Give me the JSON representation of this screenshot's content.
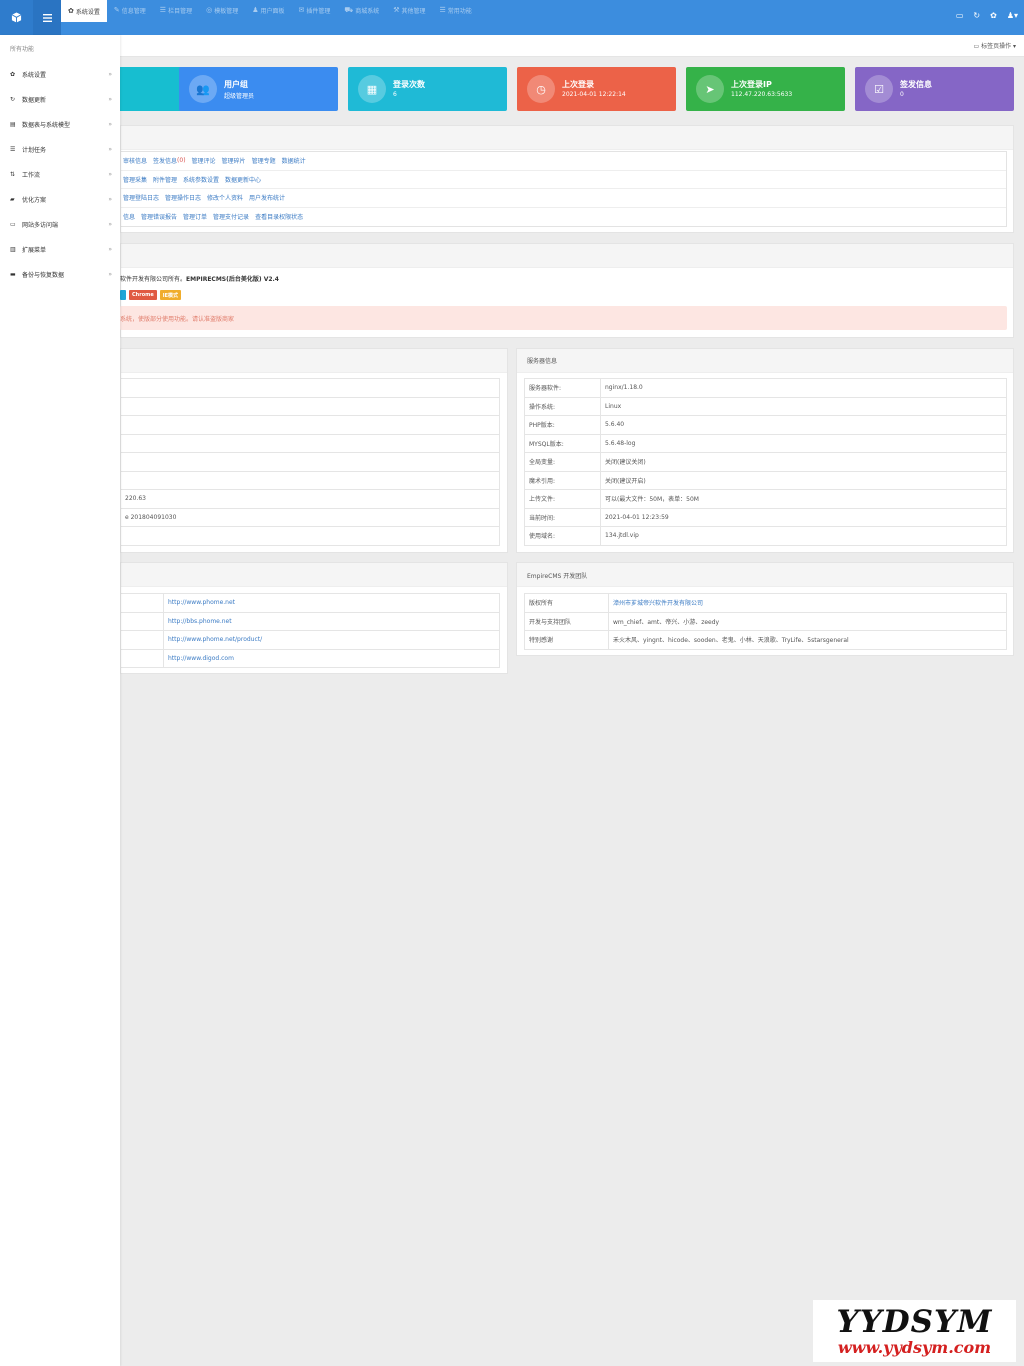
{
  "topbar": {
    "nav": [
      {
        "icon": "gear-icon",
        "glyph": "✿",
        "label": "系统设置",
        "active": true
      },
      {
        "icon": "pencil-icon",
        "glyph": "✎",
        "label": "信息管理",
        "active": false
      },
      {
        "icon": "list-icon",
        "glyph": "☰",
        "label": "栏目管理",
        "active": false
      },
      {
        "icon": "template-icon",
        "glyph": "◎",
        "label": "模板管理",
        "active": false
      },
      {
        "icon": "user-icon",
        "glyph": "♟",
        "label": "用户面板",
        "active": false
      },
      {
        "icon": "mail-icon",
        "glyph": "✉",
        "label": "插件管理",
        "active": false
      },
      {
        "icon": "cart-icon",
        "glyph": "⛟",
        "label": "商城系统",
        "active": false
      },
      {
        "icon": "wrench-icon",
        "glyph": "⚒",
        "label": "其他管理",
        "active": false
      },
      {
        "icon": "list-icon",
        "glyph": "☰",
        "label": "常用功能",
        "active": false
      }
    ]
  },
  "sidebar": {
    "header": "所有功能",
    "items": [
      {
        "icon": "gear-icon",
        "glyph": "✿",
        "label": "系统设置"
      },
      {
        "icon": "refresh-icon",
        "glyph": "↻",
        "label": "数据更新"
      },
      {
        "icon": "table-icon",
        "glyph": "▤",
        "label": "数据表与系统模型"
      },
      {
        "icon": "tasks-icon",
        "glyph": "☰",
        "label": "计划任务"
      },
      {
        "icon": "sort-icon",
        "glyph": "⇅",
        "label": "工作流"
      },
      {
        "icon": "book-icon",
        "glyph": "▰",
        "label": "优化方案"
      },
      {
        "icon": "monitor-icon",
        "glyph": "▭",
        "label": "网站多访问端"
      },
      {
        "icon": "menu-icon",
        "glyph": "▥",
        "label": "扩展菜单"
      },
      {
        "icon": "archive-icon",
        "glyph": "▬",
        "label": "备份与恢复数据"
      }
    ]
  },
  "subbar": {
    "label": "标签页操作"
  },
  "stats": [
    {
      "title": "",
      "value": "",
      "color": "#17bed0",
      "glyph": ""
    },
    {
      "title": "用户组",
      "value": "超级管理员",
      "color": "#3b8cf0",
      "glyph": "👥"
    },
    {
      "title": "登录次数",
      "value": "6",
      "color": "#1fbad6",
      "glyph": "▦"
    },
    {
      "title": "上次登录",
      "value": "2021-04-01 12:22:14",
      "color": "#ec6248",
      "glyph": "◷"
    },
    {
      "title": "上次登录IP",
      "value": "112.47.220.63:5633",
      "color": "#35b249",
      "glyph": "➤"
    },
    {
      "title": "签发信息",
      "value": "0",
      "color": "#8566c6",
      "glyph": "☑"
    }
  ],
  "quick_links": [
    [
      "审核信息",
      "签发信息",
      "(0)",
      "管理评论",
      "管理碎片",
      "管理专题",
      "数据统计"
    ],
    [
      "管理采集",
      "附件管理",
      "系统参数设置",
      "数据更新中心"
    ],
    [
      "管理登陆日志",
      "管理操作日志",
      "修改个人资料",
      "用户发布统计"
    ],
    [
      "信息",
      "管理错误报告",
      "管理订单",
      "管理支付记录",
      "查看目录权限状态"
    ]
  ],
  "system": {
    "line_prefix": "软件开发有限公司所有。",
    "line_product": "EMPIRECMS(后台美化版) V2.4",
    "badges": [
      {
        "label": "",
        "color": "#1ea7d8"
      },
      {
        "label": "Chrome",
        "color": "#e05a43"
      },
      {
        "label": "IE模式",
        "color": "#f0ad2c"
      }
    ],
    "alert": "系统，使版部分使用功能。请认准盗版商家"
  },
  "left_info": {
    "rows": [
      "",
      "",
      "",
      "",
      "",
      "",
      "220.63",
      "e 201804091030",
      ""
    ]
  },
  "server_info": {
    "title": "服务器信息",
    "rows": [
      [
        "服务器软件:",
        "nginx/1.18.0"
      ],
      [
        "操作系统:",
        "Linux"
      ],
      [
        "PHP版本:",
        "5.6.40"
      ],
      [
        "MYSQL版本:",
        "5.6.48-log"
      ],
      [
        "全局变量:",
        "关闭(建议关闭)"
      ],
      [
        "魔术引用:",
        "关闭(建议开启)"
      ],
      [
        "上传文件:",
        "可以(最大文件：50M，表单：50M"
      ],
      [
        "当前时间:",
        "2021-04-01 12:23:59"
      ],
      [
        "使用域名:",
        "134.jtdl.vip"
      ]
    ]
  },
  "official_links": {
    "rows": [
      "http://www.phome.net",
      "http://bbs.phome.net",
      "http://www.phome.net/product/",
      "http://www.digod.com"
    ]
  },
  "team": {
    "title": "EmpireCMS 开发团队",
    "rows": [
      [
        "版权所有",
        "漳州市芗城帝兴软件开发有限公司"
      ],
      [
        "开发与支持团队",
        "wm_chief、amt、帝兴、小游、zeedy"
      ],
      [
        "特别感谢",
        "禾火木风、yingnt、hicode、sooden、老鬼、小林、天浪歌、TryLife、5starsgeneral"
      ]
    ]
  },
  "watermark": {
    "line1": "YYDSYM",
    "line2": "www.yydsym.com"
  }
}
